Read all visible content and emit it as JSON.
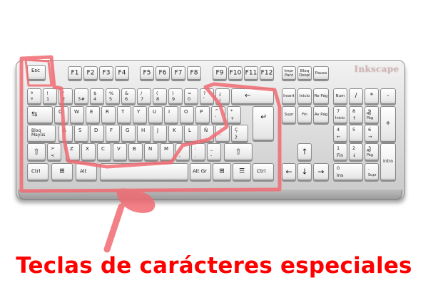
{
  "logo_text": "Inkscape",
  "caption": "Teclas de carácteres especiales",
  "highlight_color": "#f06a72",
  "caption_color": "#ff0000",
  "keys": {
    "esc": "Esc",
    "f1": "F1",
    "f2": "F2",
    "f3": "F3",
    "f4": "F4",
    "f5": "F5",
    "f6": "F6",
    "f7": "F7",
    "f8": "F8",
    "f9": "F9",
    "f10": "F10",
    "f11": "F11",
    "f12": "F12",
    "impr": "Impr Pant",
    "bloq_desp": "Bloq Despl",
    "pausa": "Pausa",
    "grave_top": "ª",
    "grave_bot": "º",
    "n1_top": "!",
    "n1_bot": "1",
    "n2_top": "\"",
    "n2_bot": "2",
    "n3_top": "$",
    "n3_bot": "3",
    "n3b_top": "·",
    "n3b_bot": "#",
    "n4_top": "$",
    "n4_bot": "4",
    "n5_top": "%",
    "n5_bot": "5",
    "n6_top": "&",
    "n6_bot": "6",
    "n7_top": "/",
    "n7_bot": "7",
    "n8_top": "(",
    "n8_bot": "8",
    "n9_top": ")",
    "n9_bot": "9",
    "n0_top": "=",
    "n0_bot": "0",
    "apos_top": "?",
    "apos_bot": "'",
    "excl_top": "¿",
    "excl_bot": "¡",
    "backspace": "←",
    "tab": "⇆",
    "q": "Q",
    "w": "W",
    "e": "E",
    "r": "R",
    "t": "T",
    "y": "Y",
    "u": "U",
    "i": "I",
    "o": "O",
    "p": "P",
    "brk_top": "^",
    "brk_bot": "`",
    "plus_top": "*",
    "plus_bot": "+",
    "enter": "↵",
    "bloq_mayus": "Bloq Mayús",
    "a": "A",
    "s": "S",
    "d": "D",
    "f": "F",
    "g": "G",
    "h": "H",
    "j": "J",
    "k": "K",
    "l": "L",
    "enye": "Ñ",
    "acc_top": "¨",
    "acc_bot": "´",
    "cced_top": "Ç",
    "cced_bot": "}",
    "shift_l": "⇧",
    "lt_top": ">",
    "lt_bot": "<",
    "z": "Z",
    "x": "X",
    "c": "C",
    "v": "V",
    "b": "B",
    "n": "N",
    "m": "M",
    "comma_top": ";",
    "comma_bot": ",",
    "dot_top": ":",
    "dot_bot": ".",
    "dash_top": "_",
    "dash_bot": "-",
    "shift_r": "⇧",
    "ctrl_l": "Ctrl",
    "win_l": "⊞",
    "alt": "Alt",
    "altgr": "Alt Gr",
    "win_r": "⊞",
    "menu": "☰",
    "ctrl_r": "Ctrl",
    "insert": "Insert",
    "inicio": "Inicio",
    "re_pag": "Re Pág",
    "supr": "Supr",
    "fin": "Fin",
    "av_pag": "Av Pág",
    "up": "↑",
    "left": "←",
    "down": "↓",
    "right": "→",
    "num": "Num",
    "slash": "/",
    "star": "*",
    "minus": "-",
    "kp7_top": "7",
    "kp7_bot": "Inicio",
    "kp8_top": "8",
    "kp8_bot": "↑",
    "kp9_top": "9",
    "kp9_bot": "Re Pág",
    "kp_plus": "+",
    "kp4_top": "4",
    "kp4_bot": "←",
    "kp5": "5",
    "kp6_top": "6",
    "kp6_bot": "→",
    "kp1_top": "1",
    "kp1_bot": "Fin",
    "kp2_top": "2",
    "kp2_bot": "↓",
    "kp3_top": "3",
    "kp3_bot": "Av Pág",
    "kp_intro": "Intro",
    "kp0_top": "0",
    "kp0_bot": "Ins",
    "kpdot_top": ".",
    "kpdot_bot": "Supr"
  }
}
